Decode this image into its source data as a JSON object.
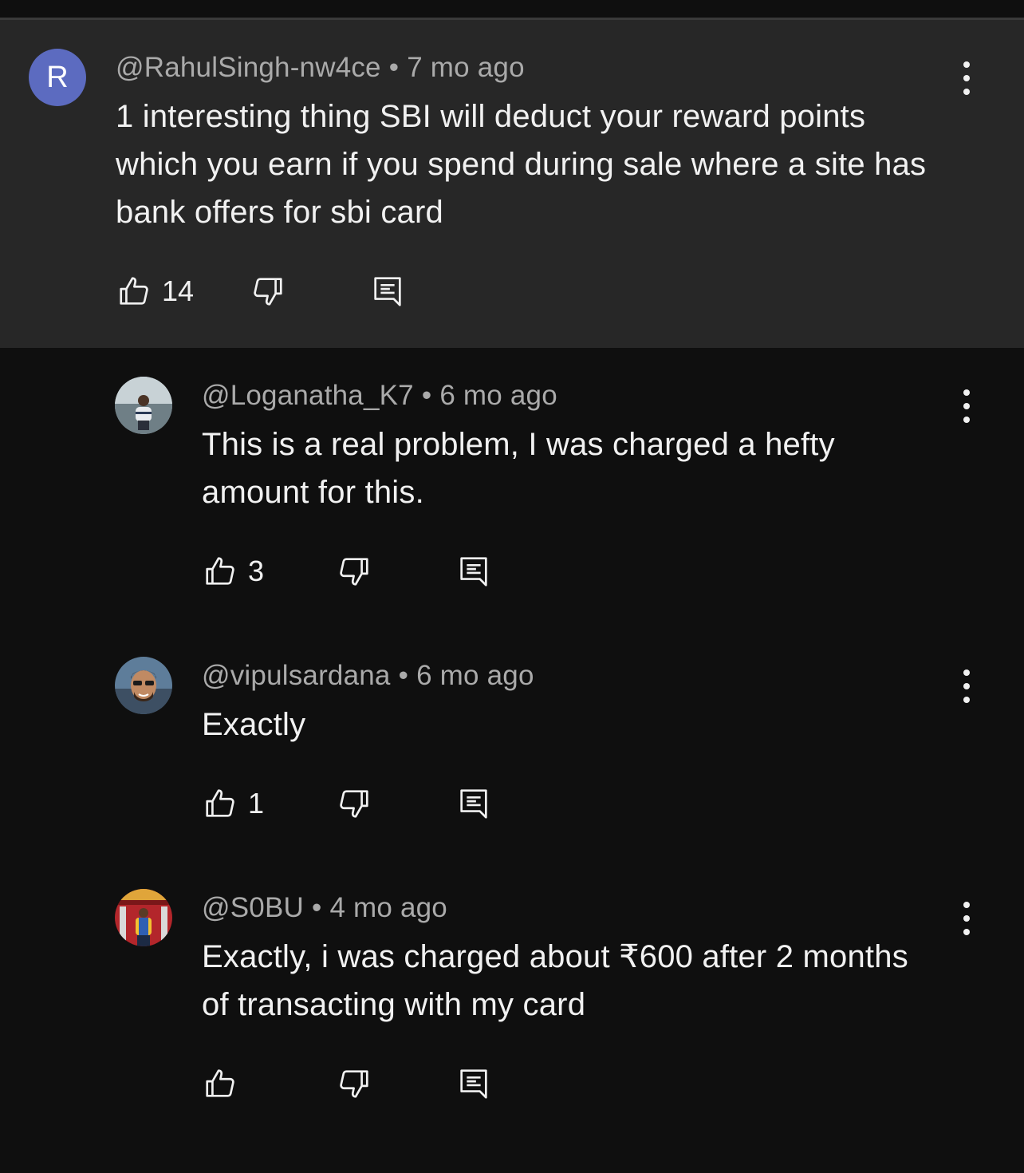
{
  "comments": [
    {
      "avatar_letter": "R",
      "avatar_color": "#5c6bc0",
      "author": "@RahulSingh-nw4ce",
      "separator": "•",
      "time": "7 mo ago",
      "text": "1 interesting thing SBI will deduct your reward points which you earn if you spend during sale where a site has bank offers for sbi card",
      "likes": "14",
      "highlighted": true
    },
    {
      "author": "@Loganatha_K7",
      "separator": "•",
      "time": "6 mo ago",
      "text": "This is a real problem, I was charged a hefty amount for this.",
      "likes": "3"
    },
    {
      "author": "@vipulsardana",
      "separator": "•",
      "time": "6 mo ago",
      "text": "Exactly",
      "likes": "1"
    },
    {
      "author": "@S0BU",
      "separator": "•",
      "time": "4 mo ago",
      "text": "Exactly, i was charged about ₹600 after 2 months of transacting with my card",
      "likes": ""
    }
  ],
  "colors": {
    "background": "#0f0f0f",
    "highlight_background": "#272727",
    "text_primary": "#f1f1f1",
    "text_secondary": "#aaaaaa"
  },
  "icons": {
    "like": "thumbs-up-icon",
    "dislike": "thumbs-down-icon",
    "reply": "reply-icon",
    "more": "more-vert-icon"
  }
}
